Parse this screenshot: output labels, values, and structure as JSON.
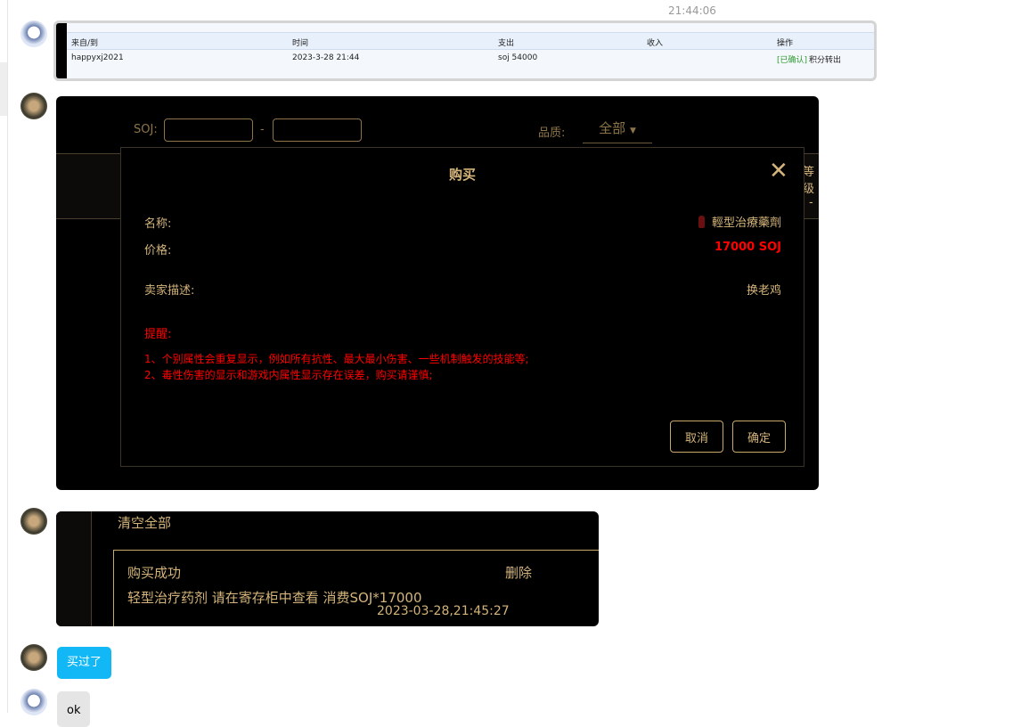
{
  "chat": {
    "timestamp": "21:44:06",
    "messages": [
      {
        "text": "买过了"
      },
      {
        "text": "ok"
      }
    ]
  },
  "transfer_table": {
    "headers": [
      "来自/到",
      "时间",
      "支出",
      "收入",
      "操作"
    ],
    "row": {
      "from": "happyxj2021",
      "time": "2023-3-28 21:44",
      "expense": "soj 54000",
      "income": "",
      "status": "[已确认]",
      "action": "积分转出"
    }
  },
  "market": {
    "soj_label": "SOJ:",
    "dash": "-",
    "quality_label": "品质:",
    "quality_value": "全部",
    "side_text": "等级",
    "side_dash": "-"
  },
  "modal": {
    "title": "购买",
    "name_label": "名称:",
    "name_value": "輕型治療藥劑",
    "price_label": "价格:",
    "price_value": "17000 SOJ",
    "desc_label": "卖家描述:",
    "desc_value": "换老鸡",
    "warning_title": "提醒:",
    "warnings": [
      "1、个别属性会重复显示，例如所有抗性、最大最小伤害、一些机制触发的技能等;",
      "2、毒性伤害的显示和游戏内属性显示存在误差，购买请谨慎;"
    ],
    "cancel": "取消",
    "confirm": "确定"
  },
  "notice": {
    "clear_all": "清空全部",
    "title": "购买成功",
    "delete": "删除",
    "body": "轻型治疗药剂 请在寄存柜中查看 消费SOJ*17000",
    "time": "2023-03-28,21:45:27"
  },
  "colors": {
    "tan": "#d4b47a",
    "red": "#ff0000",
    "bubble_blue": "#12b7f5"
  }
}
